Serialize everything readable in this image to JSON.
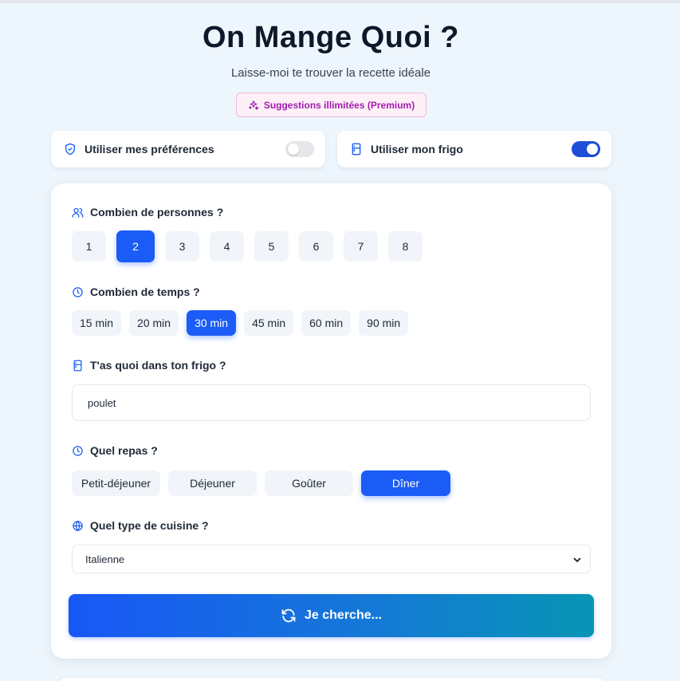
{
  "header": {
    "title": "On Mange Quoi ?",
    "subtitle": "Laisse-moi te trouver la recette idéale",
    "premium_label": "Suggestions illimitées (Premium)"
  },
  "toggles": [
    {
      "label": "Utiliser mes préférences",
      "on": false,
      "icon": "shield-check-icon"
    },
    {
      "label": "Utiliser mon frigo",
      "on": true,
      "icon": "fridge-icon"
    }
  ],
  "people": {
    "label": "Combien de personnes ?",
    "icon": "users-icon",
    "options": [
      "1",
      "2",
      "3",
      "4",
      "5",
      "6",
      "7",
      "8"
    ],
    "selected": "2"
  },
  "time": {
    "label": "Combien de temps ?",
    "icon": "clock-icon",
    "options": [
      "15 min",
      "20 min",
      "30 min",
      "45 min",
      "60 min",
      "90 min"
    ],
    "selected": "30 min"
  },
  "fridge": {
    "label": "T'as quoi dans ton frigo ?",
    "icon": "fridge-icon",
    "value": "poulet"
  },
  "meal": {
    "label": "Quel repas ?",
    "icon": "clock-icon",
    "options": [
      "Petit-déjeuner",
      "Déjeuner",
      "Goûter",
      "Dîner"
    ],
    "selected": "Dîner"
  },
  "cuisine": {
    "label": "Quel type de cuisine ?",
    "icon": "globe-icon",
    "selected": "Italienne"
  },
  "search_button": {
    "label": "Je cherche...",
    "icon": "refresh-icon"
  },
  "colors": {
    "accent": "#1a5cf5",
    "premium_text": "#a21caf",
    "button_gradient_end": "#0795b5"
  }
}
